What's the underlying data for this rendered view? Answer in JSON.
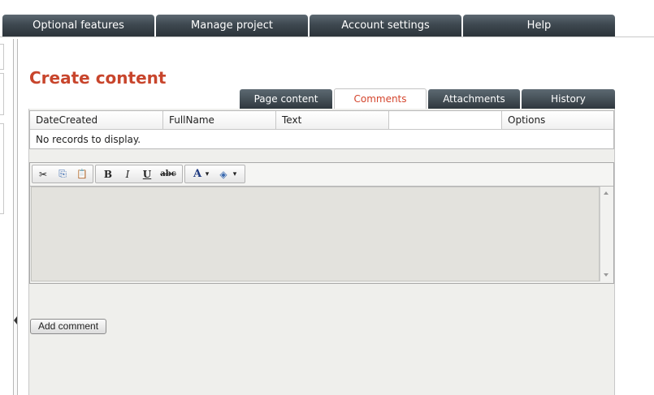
{
  "nav": {
    "items": [
      {
        "label": "Optional features"
      },
      {
        "label": "Manage project"
      },
      {
        "label": "Account settings"
      },
      {
        "label": "Help"
      }
    ]
  },
  "page": {
    "title": "Create content"
  },
  "tabs": [
    {
      "label": "Page content",
      "active": false
    },
    {
      "label": "Comments",
      "active": true
    },
    {
      "label": "Attachments",
      "active": false
    },
    {
      "label": "History",
      "active": false
    }
  ],
  "grid": {
    "columns": [
      "DateCreated",
      "FullName",
      "Text",
      "",
      "Options"
    ],
    "empty_message": "No records to display."
  },
  "editor": {
    "toolbar": {
      "cut": "✂",
      "copy": "⎘",
      "paste": "📋",
      "bold": "B",
      "italic": "I",
      "underline": "U",
      "strike": "abc",
      "font_color": "A",
      "back_color": "◈",
      "dropdown": "▾"
    }
  },
  "actions": {
    "add_comment": "Add comment"
  },
  "colors": {
    "accent": "#c8452c",
    "nav_bg": "#3e4850"
  }
}
